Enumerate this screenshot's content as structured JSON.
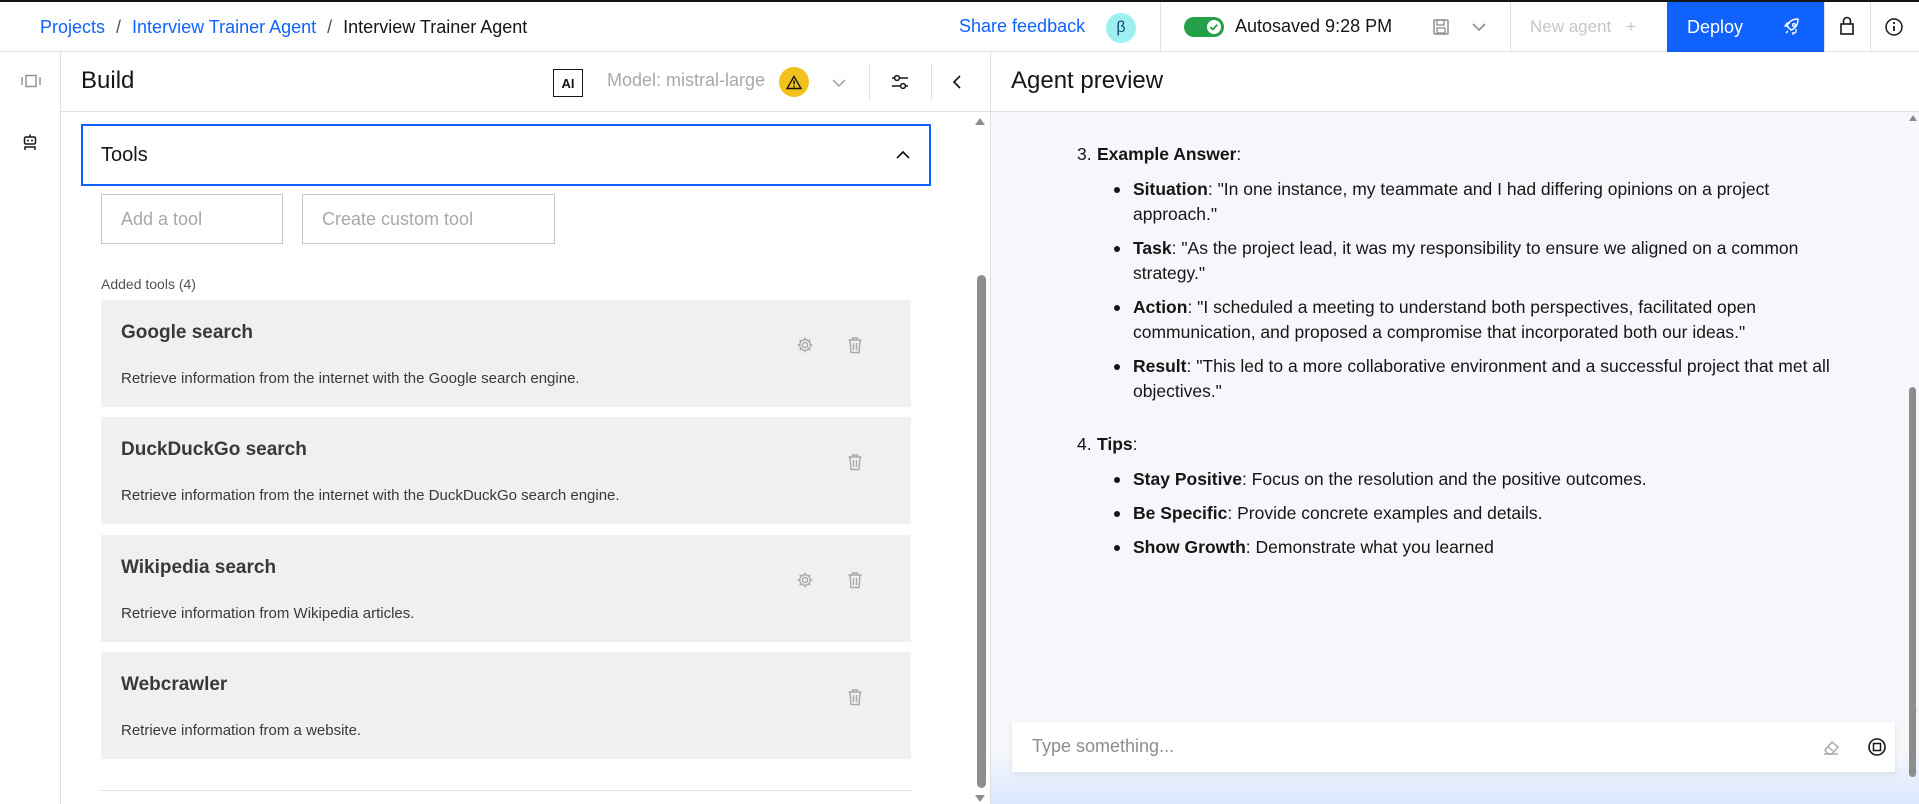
{
  "breadcrumb": {
    "items": [
      "Projects",
      "Interview Trainer Agent",
      "Interview Trainer Agent"
    ],
    "separator": "/"
  },
  "header": {
    "share_feedback": "Share feedback",
    "beta_badge": "β",
    "autosaved": "Autosaved 9:28 PM",
    "new_agent": "New agent",
    "new_agent_plus": "+",
    "deploy": "Deploy"
  },
  "build": {
    "title": "Build",
    "ai_badge": "AI",
    "model_label": "Model: mistral-large",
    "tools_section": {
      "title": "Tools",
      "add_tool_placeholder": "Add a tool",
      "create_custom_tool_placeholder": "Create custom tool",
      "added_label": "Added tools (4)",
      "tools": [
        {
          "name": "Google search",
          "description": "Retrieve information from the internet with the Google search engine.",
          "has_settings": true
        },
        {
          "name": "DuckDuckGo search",
          "description": "Retrieve information from the internet with the DuckDuckGo search engine.",
          "has_settings": false
        },
        {
          "name": "Wikipedia search",
          "description": "Retrieve information from Wikipedia articles.",
          "has_settings": true
        },
        {
          "name": "Webcrawler",
          "description": "Retrieve information from a website.",
          "has_settings": false
        }
      ]
    }
  },
  "preview": {
    "title": "Agent preview",
    "sections": [
      {
        "number": "3.",
        "heading": "Example Answer",
        "bullets": [
          {
            "term": "Situation",
            "text": ": \"In one instance, my teammate and I had differing opinions on a project approach.\""
          },
          {
            "term": "Task",
            "text": ": \"As the project lead, it was my responsibility to ensure we aligned on a common strategy.\""
          },
          {
            "term": "Action",
            "text": ": \"I scheduled a meeting to understand both perspectives, facilitated open communication, and proposed a compromise that incorporated both our ideas.\""
          },
          {
            "term": "Result",
            "text": ": \"This led to a more collaborative environment and a successful project that met all objectives.\""
          }
        ]
      },
      {
        "number": "4.",
        "heading": "Tips",
        "bullets": [
          {
            "term": "Stay Positive",
            "text": ": Focus on the resolution and the positive outcomes."
          },
          {
            "term": "Be Specific",
            "text": ": Provide concrete examples and details."
          },
          {
            "term": "Show Growth",
            "text": ": Demonstrate what you learned"
          }
        ]
      }
    ],
    "input_placeholder": "Type something..."
  },
  "colors": {
    "accent": "#0f62fe",
    "toggle_on": "#24a148",
    "warning": "#f1c21b",
    "beta_bg": "#9ef0f0"
  },
  "icons": [
    "sidebar-toggle-icon",
    "agent-icon",
    "save-icon",
    "chevron-down-icon",
    "rocket-icon",
    "lock-icon",
    "info-icon",
    "warning-icon",
    "settings-sliders-icon",
    "chevron-left-icon",
    "chevron-up-icon",
    "gear-icon",
    "trash-icon",
    "eraser-icon",
    "stop-icon"
  ]
}
